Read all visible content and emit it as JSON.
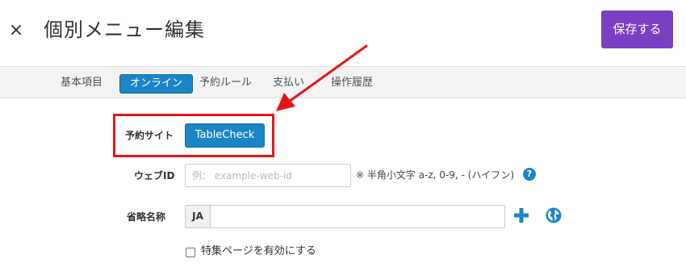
{
  "header": {
    "close_glyph": "×",
    "title": "個別メニュー編集",
    "save_label": "保存する"
  },
  "tabs": [
    {
      "label": "基本項目",
      "active": false
    },
    {
      "label": "オンライン",
      "active": true
    },
    {
      "label": "予約ルール",
      "active": false
    },
    {
      "label": "支払い",
      "active": false
    },
    {
      "label": "操作履歴",
      "active": false
    }
  ],
  "form": {
    "reservation_site": {
      "label": "予約サイト",
      "value": "TableCheck"
    },
    "web_id": {
      "label": "ウェブID",
      "placeholder": "例： example-web-id",
      "hint": "※ 半角小文字 a-z, 0-9, - (ハイフン)",
      "help_glyph": "?"
    },
    "short_name": {
      "label": "省略名称",
      "lang": "JA",
      "value": ""
    },
    "feature_page": {
      "label": "特集ページを有効にする",
      "checked": false
    }
  },
  "colors": {
    "accent_purple": "#7b3fc4",
    "accent_blue": "#1b86c6",
    "highlight_red": "#e4161b"
  },
  "icons": {
    "close": "close-icon",
    "help": "help-icon",
    "add": "plus-icon",
    "translate": "globe-icon"
  }
}
